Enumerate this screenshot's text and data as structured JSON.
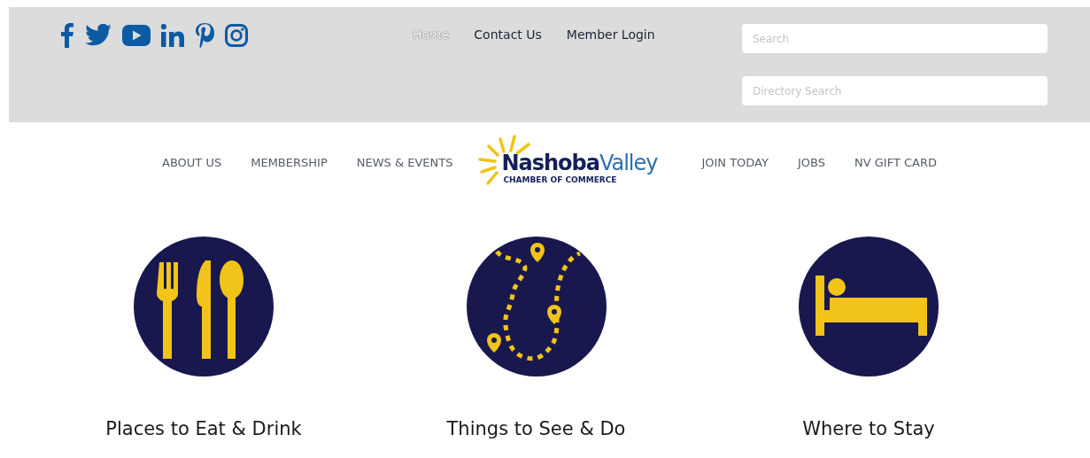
{
  "top_nav": [
    {
      "label": "Home",
      "selected": true
    },
    {
      "label": "Contact Us",
      "selected": false
    },
    {
      "label": "Member Login",
      "selected": false
    }
  ],
  "search_fields": [
    {
      "placeholder": "Search"
    },
    {
      "placeholder": "Directory Search"
    }
  ],
  "main_nav_left": [
    "ABOUT US",
    "MEMBERSHIP",
    "NEWS & EVENTS"
  ],
  "logo": {
    "name_bold": "Nashoba",
    "name_light": "Valley",
    "tagline": "CHAMBER OF COMMERCE"
  },
  "main_nav_right": [
    "JOIN TODAY",
    "JOBS",
    "NV GIFT CARD"
  ],
  "categories": [
    {
      "kind": "dining",
      "label": "Places to Eat & Drink"
    },
    {
      "kind": "map",
      "label": "Things to See & Do"
    },
    {
      "kind": "lodging",
      "label": "Where to Stay"
    }
  ]
}
